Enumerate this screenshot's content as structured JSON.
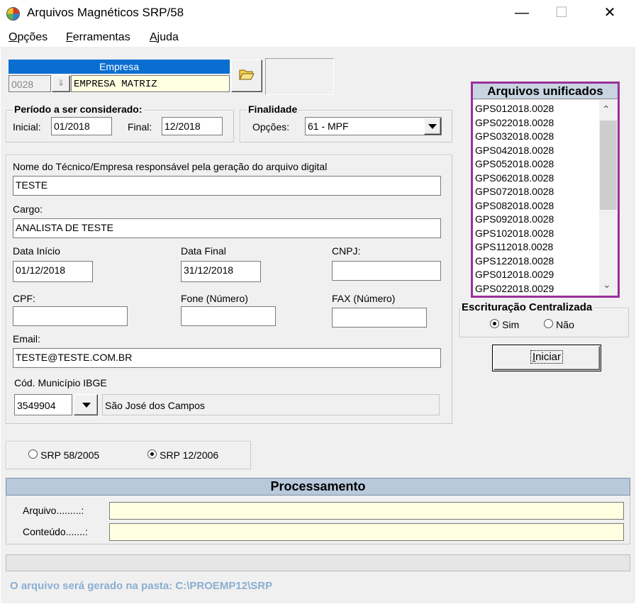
{
  "window": {
    "title": "Arquivos Magnéticos SRP/58",
    "minimize": "—",
    "maximize": "☐",
    "close": "✕"
  },
  "menu": {
    "opcoes": "Opções",
    "ferramentas": "Ferramentas",
    "ajuda": "Ajuda"
  },
  "empresa": {
    "header": "Empresa",
    "code": "0028",
    "name": "EMPRESA MATRIZ"
  },
  "periodo": {
    "legend": "Período a ser considerado:",
    "inicial_label": "Inicial:",
    "inicial": "01/2018",
    "final_label": "Final:",
    "final": "12/2018"
  },
  "finalidade": {
    "legend": "Finalidade",
    "opcoes_label": "Opções:",
    "value": "61 - MPF"
  },
  "responsavel": {
    "nome_label": "Nome do Técnico/Empresa responsável pela geração do arquivo digital",
    "nome": "TESTE",
    "cargo_label": "Cargo:",
    "cargo": "ANALISTA DE TESTE",
    "data_inicio_label": "Data Início",
    "data_inicio": "01/12/2018",
    "data_final_label": "Data Final",
    "data_final": "31/12/2018",
    "cnpj_label": "CNPJ:",
    "cnpj": "",
    "cpf_label": "CPF:",
    "cpf": "",
    "fone_label": "Fone (Número)",
    "fone": "",
    "fax_label": "FAX (Número)",
    "fax": "",
    "email_label": "Email:",
    "email": "TESTE@TESTE.COM.BR",
    "municipio_label": "Cód. Município IBGE",
    "municipio_code": "3549904",
    "municipio_name": "São José dos Campos"
  },
  "srp": {
    "opt1": "SRP 58/2005",
    "opt2": "SRP 12/2006",
    "selected": "opt2"
  },
  "arquivos": {
    "header": "Arquivos unificados",
    "items": [
      "GPS012018.0028",
      "GPS022018.0028",
      "GPS032018.0028",
      "GPS042018.0028",
      "GPS052018.0028",
      "GPS062018.0028",
      "GPS072018.0028",
      "GPS082018.0028",
      "GPS092018.0028",
      "GPS102018.0028",
      "GPS112018.0028",
      "GPS122018.0028",
      "GPS012018.0029",
      "GPS022018.0029"
    ]
  },
  "escrituracao": {
    "legend": "Escrituração Centralizada",
    "sim": "Sim",
    "nao": "Não",
    "selected": "sim"
  },
  "iniciar": "Iniciar",
  "processamento": {
    "header": "Processamento",
    "arquivo_label": "Arquivo.........:",
    "arquivo": "",
    "conteudo_label": "Conteúdo.......:",
    "conteudo": ""
  },
  "status": {
    "pasta": "O arquivo será gerado na pasta: C:\\PROEMP12\\SRP"
  },
  "colors": {
    "accent_border": "#9b2f9b",
    "header_blue": "#0a6ed1",
    "status_text": "#8aaed0"
  }
}
